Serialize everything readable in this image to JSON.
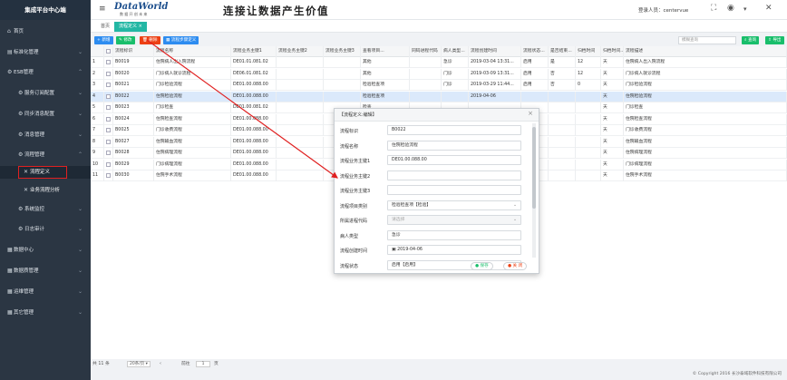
{
  "app_title": "集成平台中心端",
  "header": {
    "logo_main": "DataWorld",
    "logo_sub": "数 据 开 创 未 来",
    "slogan": "连接让数据产生价值",
    "user_text": "登录人员：centervue"
  },
  "sidebar": {
    "items": [
      {
        "label": "首页",
        "icon": "home-icon"
      },
      {
        "label": "标准化管理",
        "icon": "standard-icon"
      },
      {
        "label": "ESB管理",
        "icon": "esb-icon"
      },
      {
        "label": "服务订阅配置",
        "icon": "subscribe-icon"
      },
      {
        "label": "同步消息配置",
        "icon": "sync-icon"
      },
      {
        "label": "消息管理",
        "icon": "message-icon"
      },
      {
        "label": "流程管理",
        "icon": "flow-icon"
      },
      {
        "label": "流程定义",
        "icon": "flow-def-icon"
      },
      {
        "label": "业务流程分析",
        "icon": "analysis-icon"
      },
      {
        "label": "系统监控",
        "icon": "monitor-icon"
      },
      {
        "label": "日志审计",
        "icon": "log-icon"
      },
      {
        "label": "数据中心",
        "icon": "datacenter-icon"
      },
      {
        "label": "数据质管理",
        "icon": "quality-icon"
      },
      {
        "label": "运维管理",
        "icon": "ops-icon"
      },
      {
        "label": "其它管理",
        "icon": "other-icon"
      }
    ]
  },
  "tabs": {
    "home": "首页",
    "current": "流程定义"
  },
  "toolbar": {
    "add": "新增",
    "edit": "修改",
    "delete": "删除",
    "flow_edit": "流程步骤定义",
    "search_placeholder": "模糊查询",
    "query": "查询",
    "export": "导出"
  },
  "table": {
    "columns": [
      "",
      "",
      "流程标识",
      "流程名称",
      "流程业务主键1",
      "流程业务主键2",
      "流程业务主键3",
      "查看项目...",
      "同码进程代码",
      "病人类型...",
      "流程创建时间",
      "流程状态...",
      "是否结束...",
      "归档时间",
      "归档时间...",
      "流程描述"
    ],
    "rows": [
      [
        "1",
        "B0019",
        "住院病人出入院流程",
        "DE01.01.081.02",
        "",
        "",
        "其他",
        "",
        "急诊",
        "2019-03-04 13:31...",
        "启用",
        "是",
        "12",
        "天",
        "住院病人出入院流程"
      ],
      [
        "2",
        "B0020",
        "门诊病人就诊流程",
        "DE06.01.081.02",
        "",
        "",
        "其他",
        "",
        "门诊",
        "2019-03-09 13:31...",
        "启用",
        "否",
        "12",
        "天",
        "门诊病人就诊流程"
      ],
      [
        "3",
        "B0021",
        "门诊检验流程",
        "DE01.00.088.00",
        "",
        "",
        "检验检查项",
        "",
        "门诊",
        "2019-03-29 11:44...",
        "启用",
        "否",
        "0",
        "天",
        "门诊检验流程"
      ],
      [
        "4",
        "B0022",
        "住院检验流程",
        "DE01.00.088.00",
        "",
        "",
        "检验检查项",
        "",
        "",
        "2019-04-06",
        "",
        "",
        "",
        "天",
        "住院检验流程"
      ],
      [
        "5",
        "B0023",
        "门诊检查",
        "DE01.00.081.02",
        "",
        "",
        "检查",
        "",
        "",
        "",
        "",
        "",
        "",
        "天",
        "门诊检查"
      ],
      [
        "6",
        "B0024",
        "住院检查流程",
        "DE01.00.088.00",
        "",
        "",
        "检查",
        "",
        "",
        "",
        "",
        "",
        "",
        "天",
        "住院检查流程"
      ],
      [
        "7",
        "B0025",
        "门诊收费流程",
        "DE01.00.088.00",
        "",
        "",
        "收费",
        "",
        "",
        "",
        "",
        "",
        "",
        "天",
        "门诊收费流程"
      ],
      [
        "8",
        "B0027",
        "住院输血流程",
        "DE01.00.088.00",
        "",
        "",
        "输血",
        "",
        "",
        "",
        "",
        "",
        "",
        "天",
        "住院输血流程"
      ],
      [
        "9",
        "B0028",
        "住院病理流程",
        "DE01.00.088.00",
        "",
        "",
        "病理",
        "",
        "",
        "",
        "",
        "",
        "",
        "天",
        "住院病理流程"
      ],
      [
        "10",
        "B0029",
        "门诊病理流程",
        "DE01.00.088.00",
        "",
        "",
        "病理",
        "",
        "",
        "",
        "",
        "",
        "",
        "天",
        "门诊病理流程"
      ],
      [
        "11",
        "B0030",
        "住院手术流程",
        "DE01.00.088.00",
        "",
        "",
        "手术",
        "",
        "",
        "",
        "",
        "",
        "",
        "天",
        "住院手术流程"
      ]
    ]
  },
  "footer": {
    "total": "共 11 条",
    "page_size": "20条/页",
    "goto_label": "前往",
    "page": "1",
    "page_unit": "页"
  },
  "copyright": "© Copyright 2016 长沙泰域软件科技有限公司",
  "modal": {
    "title": "【流程定义:编辑】",
    "fields": [
      {
        "label": "流程标识",
        "value": "B0022"
      },
      {
        "label": "流程名称",
        "value": "住院检验流程"
      },
      {
        "label": "流程业务主键1",
        "value": "DE01.00.088.00"
      },
      {
        "label": "流程业务主键2",
        "value": ""
      },
      {
        "label": "流程业务主键3",
        "value": ""
      },
      {
        "label": "流程项目类别",
        "value": "检验检查项【检验】"
      },
      {
        "label": "所属进程代码",
        "value": "请选择"
      },
      {
        "label": "病人类型",
        "value": "急诊"
      },
      {
        "label": "流程创建时间",
        "value": "2019-04-06"
      },
      {
        "label": "流程状态",
        "value": "启用【启用】"
      }
    ],
    "save": "保存",
    "close": "关 闭"
  }
}
